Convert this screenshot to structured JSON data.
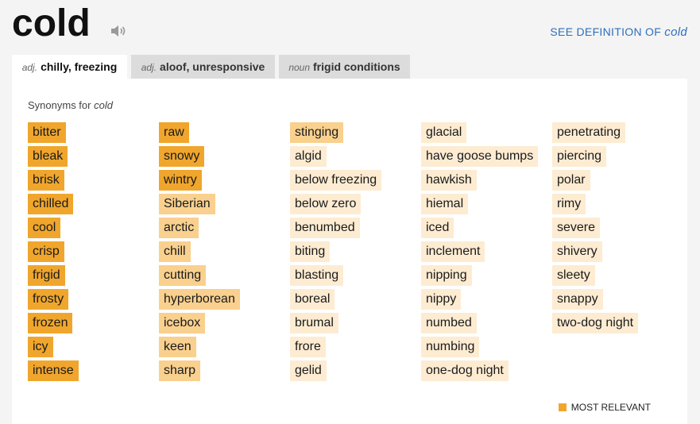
{
  "headword": "cold",
  "see_definition": {
    "prefix": "SEE DEFINITION OF ",
    "word": "cold"
  },
  "tabs": [
    {
      "pos": "adj.",
      "label": "chilly, freezing"
    },
    {
      "pos": "adj.",
      "label": "aloof, unresponsive"
    },
    {
      "pos": "noun",
      "label": "frigid conditions"
    }
  ],
  "synonyms_heading": {
    "prefix": "Synonyms for ",
    "word": "cold"
  },
  "synonyms": [
    [
      {
        "text": "bitter",
        "rel": 3
      },
      {
        "text": "bleak",
        "rel": 3
      },
      {
        "text": "brisk",
        "rel": 3
      },
      {
        "text": "chilled",
        "rel": 3
      },
      {
        "text": "cool",
        "rel": 3
      },
      {
        "text": "crisp",
        "rel": 3
      },
      {
        "text": "frigid",
        "rel": 3
      },
      {
        "text": "frosty",
        "rel": 3
      },
      {
        "text": "frozen",
        "rel": 3
      },
      {
        "text": "icy",
        "rel": 3
      },
      {
        "text": "intense",
        "rel": 3
      }
    ],
    [
      {
        "text": "raw",
        "rel": 3
      },
      {
        "text": "snowy",
        "rel": 3
      },
      {
        "text": "wintry",
        "rel": 3
      },
      {
        "text": "Siberian",
        "rel": 2
      },
      {
        "text": "arctic",
        "rel": 2
      },
      {
        "text": "chill",
        "rel": 2
      },
      {
        "text": "cutting",
        "rel": 2
      },
      {
        "text": "hyperborean",
        "rel": 2
      },
      {
        "text": "icebox",
        "rel": 2
      },
      {
        "text": "keen",
        "rel": 2
      },
      {
        "text": "sharp",
        "rel": 2
      }
    ],
    [
      {
        "text": "stinging",
        "rel": 2
      },
      {
        "text": "algid",
        "rel": 1
      },
      {
        "text": "below freezing",
        "rel": 1
      },
      {
        "text": "below zero",
        "rel": 1
      },
      {
        "text": "benumbed",
        "rel": 1
      },
      {
        "text": "biting",
        "rel": 1
      },
      {
        "text": "blasting",
        "rel": 1
      },
      {
        "text": "boreal",
        "rel": 1
      },
      {
        "text": "brumal",
        "rel": 1
      },
      {
        "text": "frore",
        "rel": 1
      },
      {
        "text": "gelid",
        "rel": 1
      }
    ],
    [
      {
        "text": "glacial",
        "rel": 1
      },
      {
        "text": "have goose bumps",
        "rel": 1
      },
      {
        "text": "hawkish",
        "rel": 1
      },
      {
        "text": "hiemal",
        "rel": 1
      },
      {
        "text": "iced",
        "rel": 1
      },
      {
        "text": "inclement",
        "rel": 1
      },
      {
        "text": "nipping",
        "rel": 1
      },
      {
        "text": "nippy",
        "rel": 1
      },
      {
        "text": "numbed",
        "rel": 1
      },
      {
        "text": "numbing",
        "rel": 1
      },
      {
        "text": "one-dog night",
        "rel": 1
      }
    ],
    [
      {
        "text": "penetrating",
        "rel": 1
      },
      {
        "text": "piercing",
        "rel": 1
      },
      {
        "text": "polar",
        "rel": 1
      },
      {
        "text": "rimy",
        "rel": 1
      },
      {
        "text": "severe",
        "rel": 1
      },
      {
        "text": "shivery",
        "rel": 1
      },
      {
        "text": "sleety",
        "rel": 1
      },
      {
        "text": "snappy",
        "rel": 1
      },
      {
        "text": "two-dog night",
        "rel": 1
      }
    ]
  ],
  "legend": {
    "label": "MOST RELEVANT",
    "color": "#f0a62c"
  },
  "icons": {
    "speaker": "speaker-icon"
  }
}
